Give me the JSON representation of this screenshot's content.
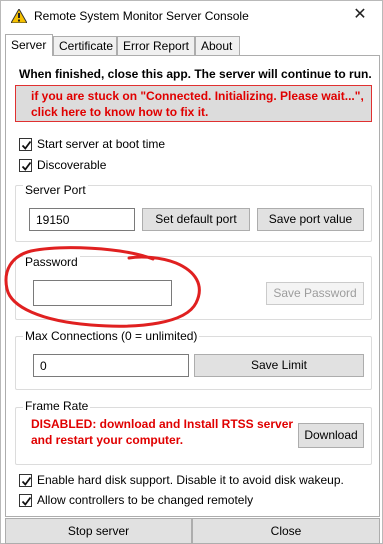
{
  "window": {
    "title": "Remote System Monitor Server Console",
    "icon": "warning-triangle-icon",
    "close_glyph": "✕"
  },
  "tabs": [
    {
      "label": "Server",
      "active": true
    },
    {
      "label": "Certificate",
      "active": false
    },
    {
      "label": "Error Report",
      "active": false
    },
    {
      "label": "About",
      "active": false
    }
  ],
  "server": {
    "note": "When finished, close this app. The server will continue to run.",
    "warning_line1": "if you are stuck on \"Connected. Initializing. Please wait...\",",
    "warning_line2": "click here to know how to fix it.",
    "start_at_boot_label": "Start server at boot time",
    "start_at_boot_checked": true,
    "discoverable_label": "Discoverable",
    "discoverable_checked": true,
    "port": {
      "legend": "Server Port",
      "value": "19150",
      "set_default_label": "Set default port",
      "save_label": "Save port value"
    },
    "password": {
      "legend": "Password",
      "value": "",
      "save_label": "Save Password",
      "save_enabled": false
    },
    "max_connections": {
      "legend": "Max Connections (0 = unlimited)",
      "value": "0",
      "save_label": "Save Limit"
    },
    "frame_rate": {
      "legend": "Frame Rate",
      "disabled_line1": "DISABLED: download and Install RTSS server",
      "disabled_line2": "and restart your computer.",
      "download_label": "Download"
    },
    "hard_disk_label": "Enable hard disk support. Disable it to avoid disk wakeup.",
    "hard_disk_checked": true,
    "controllers_label": "Allow controllers to be changed remotely",
    "controllers_checked": true
  },
  "footer": {
    "stop_label": "Stop server",
    "close_label": "Close"
  },
  "colors": {
    "warning_red": "#e00000",
    "annotation_circle": "#e02020",
    "button_face": "#e1e1e1"
  }
}
